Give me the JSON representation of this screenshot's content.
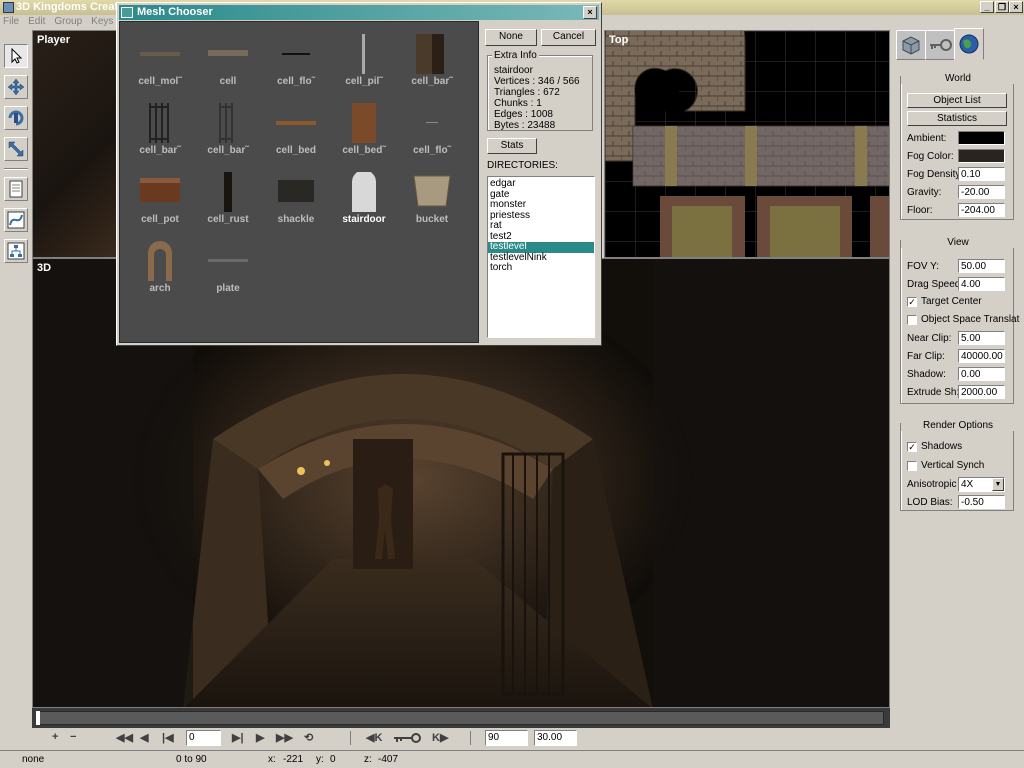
{
  "app": {
    "title": "3D Kingdoms Creator"
  },
  "menu": [
    "File",
    "Edit",
    "Group",
    "Keys"
  ],
  "viewports": {
    "player": "Player",
    "top": "Top",
    "main": "3D"
  },
  "dialog": {
    "title": "Mesh Chooser",
    "none_button": "None",
    "cancel_button": "Cancel",
    "extra_info_title": "Extra Info",
    "info": [
      "stairdoor",
      "Vertices : 346 / 566",
      "Triangles : 672",
      "Chunks : 1",
      "Edges : 1008",
      "Bytes : 23488"
    ],
    "stats_button": "Stats",
    "directories_label": "DIRECTORIES:",
    "directories": [
      "edgar",
      "gate",
      "monster",
      "priestess",
      "rat",
      "test2",
      "testlevel",
      "testlevelNink",
      "torch"
    ],
    "selected_directory": "testlevel",
    "meshes": [
      "cell_mol˜",
      "cell",
      "cell_flo˜",
      "cell_pil˜",
      "cell_bar˜",
      "cell_bar˜",
      "cell_bar˜",
      "cell_bed",
      "cell_bed˜",
      "cell_flo˜",
      "cell_pot",
      "cell_rust",
      "shackle",
      "stairdoor",
      "bucket",
      "arch",
      "plate"
    ],
    "selected_mesh": "stairdoor"
  },
  "panel": {
    "world": {
      "title": "World",
      "object_list": "Object List",
      "statistics": "Statistics",
      "ambient_label": "Ambient:",
      "ambient_color": "#000000",
      "fog_color_label": "Fog Color:",
      "fog_color": "#2a2420",
      "fog_density_label": "Fog Density:",
      "fog_density": "0.10",
      "gravity_label": "Gravity:",
      "gravity": "-20.00",
      "floor_label": "Floor:",
      "floor": "-204.00"
    },
    "view": {
      "title": "View",
      "fovy_label": "FOV Y:",
      "fovy": "50.00",
      "drag_label": "Drag Speed:",
      "drag": "4.00",
      "target_center": "Target Center",
      "object_space": "Object Space Translat",
      "near_label": "Near Clip:",
      "near": "5.00",
      "far_label": "Far Clip:",
      "far": "40000.00",
      "shadow_label": "Shadow:",
      "shadow": "0.00",
      "extrude_label": "Extrude Sh:",
      "extrude": "2000.00"
    },
    "render": {
      "title": "Render Options",
      "shadows": "Shadows",
      "vsync": "Vertical Synch",
      "aniso_label": "Anisotropic",
      "aniso": "4X",
      "lod_label": "LOD Bias:",
      "lod": "-0.50"
    }
  },
  "timeline": {
    "frame": "0",
    "range_end": "90",
    "fps": "30.00"
  },
  "status": {
    "mode": "none",
    "range": "0 to 90",
    "x_label": "x:",
    "x": "-221",
    "y_label": "y:",
    "y": "0",
    "z_label": "z:",
    "z": "-407"
  }
}
